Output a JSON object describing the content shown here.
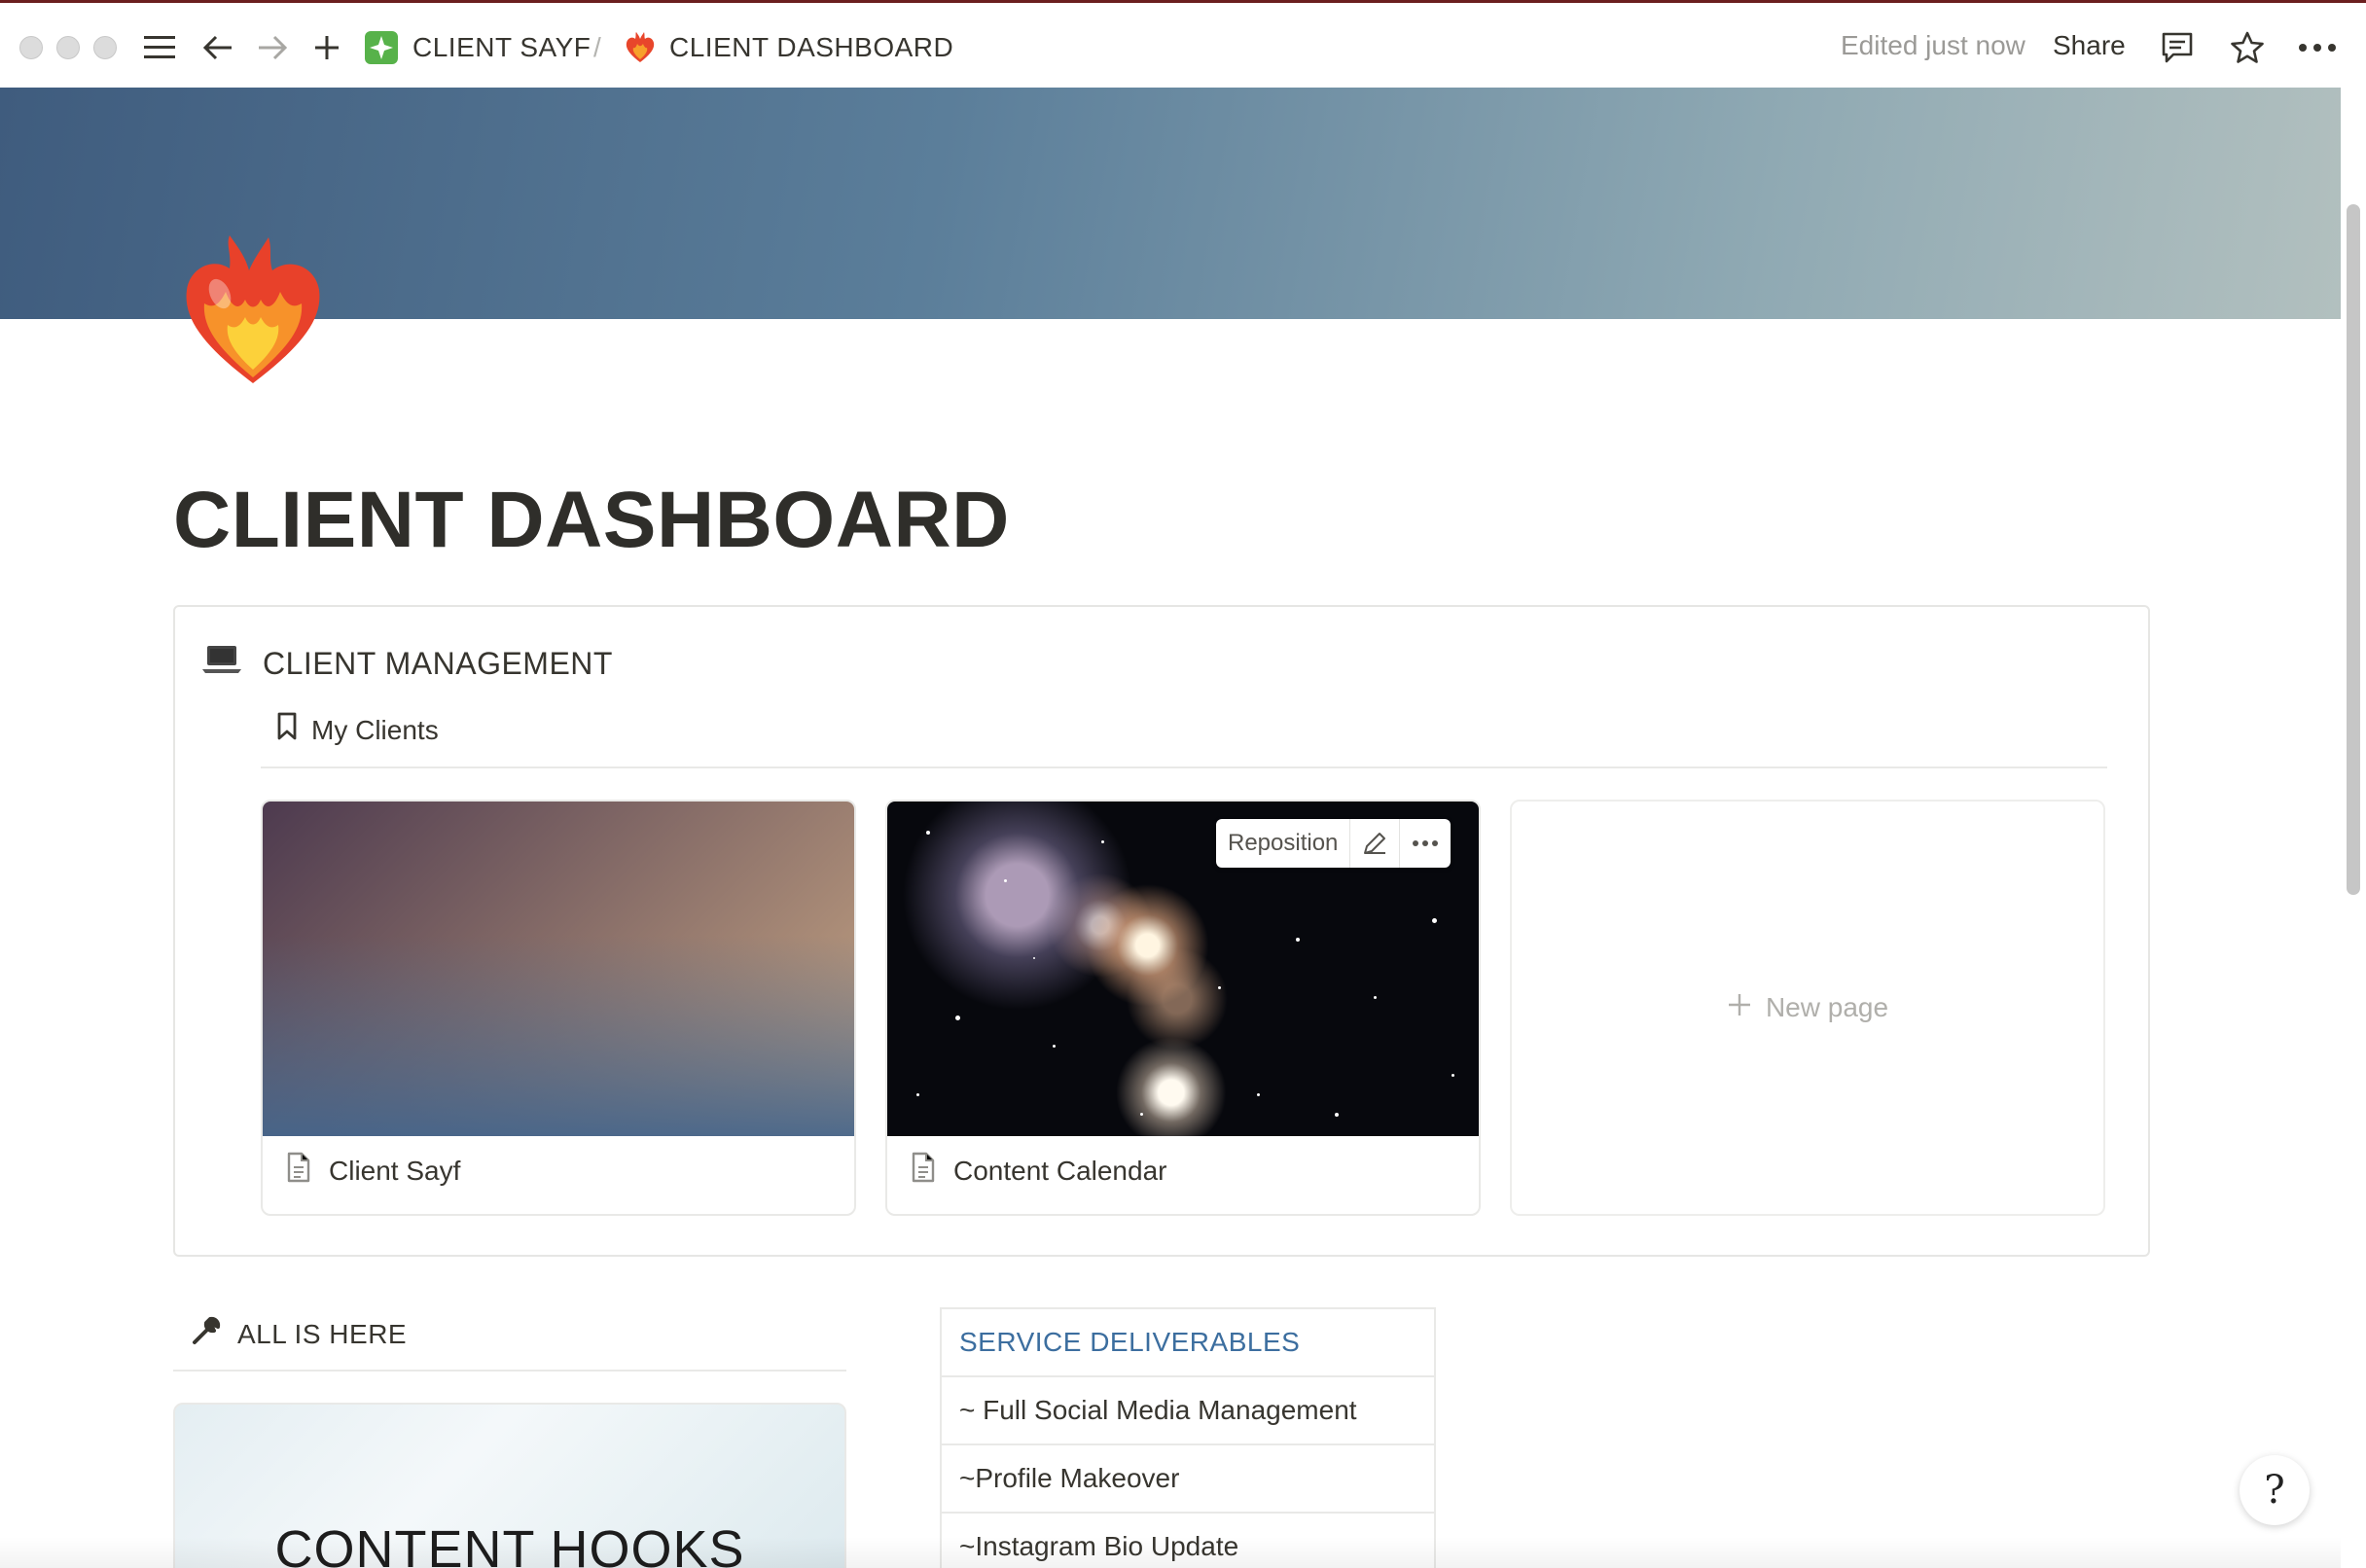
{
  "topbar": {
    "breadcrumbs": [
      {
        "label": "CLIENT SAYF",
        "icon": "sparkle-icon"
      },
      {
        "label": "CLIENT DASHBOARD",
        "icon": "heart-on-fire-icon"
      }
    ],
    "separator": "/",
    "edited": "Edited just now",
    "share": "Share"
  },
  "page": {
    "title": "CLIENT DASHBOARD",
    "icon": "heart-on-fire-icon"
  },
  "callout": {
    "heading": "CLIENT MANAGEMENT",
    "heading_icon": "laptop-icon",
    "database_view": "My Clients",
    "cards": [
      {
        "title": "Client Sayf",
        "cover": "gradient"
      },
      {
        "title": "Content Calendar",
        "cover": "galaxy-image"
      }
    ],
    "reposition": "Reposition",
    "new_page": "New page"
  },
  "lower": {
    "section_heading": "ALL IS HERE",
    "section_icon": "wrench-icon",
    "hooks_card_text": "CONTENT HOOKS",
    "services": {
      "header": "SERVICE DELIVERABLES",
      "rows": [
        "~ Full Social Media Management",
        "~Profile Makeover",
        "~Instagram Bio Update"
      ]
    }
  },
  "help_button": "?",
  "colors": {
    "accent_link": "#3c6e9f",
    "text": "#37352f",
    "muted": "#9b9a97"
  }
}
